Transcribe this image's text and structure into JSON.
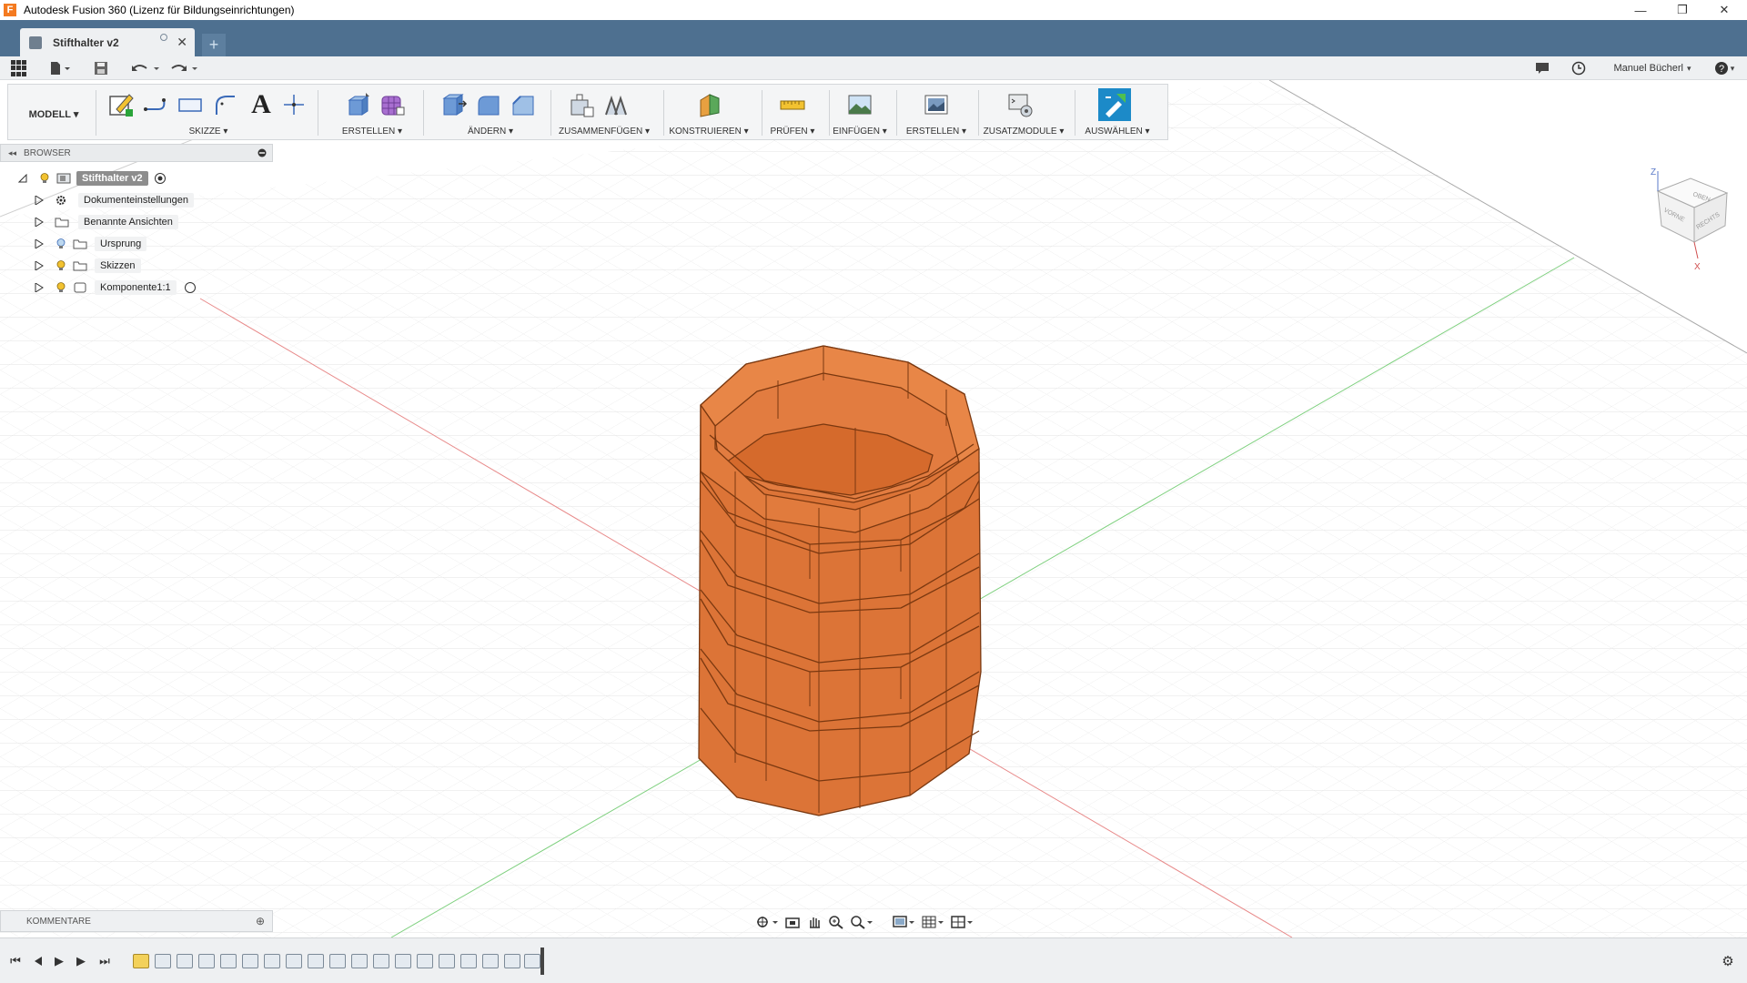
{
  "window": {
    "title": "Autodesk Fusion 360 (Lizenz für Bildungseinrichtungen)",
    "app_logo": "F",
    "minimize_icon": "—",
    "restore_icon": "❐",
    "close_icon": "✕"
  },
  "document_tab": {
    "name": "Stifthalter v2",
    "close_icon": "✕",
    "new_tab_icon": "+"
  },
  "quick_access": {
    "file_icon": "file-icon",
    "save_icon": "save-icon",
    "undo_icon": "undo-icon",
    "redo_icon": "redo-icon",
    "user_name": "Manuel Bücherl",
    "user_caret": "▾",
    "help_caret": "▾"
  },
  "ribbon": {
    "mode": "MODELL ▾",
    "groups": [
      {
        "label": "SKIZZE ▾"
      },
      {
        "label": "ERSTELLEN ▾"
      },
      {
        "label": "ÄNDERN ▾"
      },
      {
        "label": "ZUSAMMENFÜGEN ▾"
      },
      {
        "label": "KONSTRUIEREN ▾"
      },
      {
        "label": "PRÜFEN ▾"
      },
      {
        "label": "EINFÜGEN ▾"
      },
      {
        "label": "ERSTELLEN ▾"
      },
      {
        "label": "ZUSATZMODULE ▾"
      },
      {
        "label": "AUSWÄHLEN ▾"
      }
    ],
    "text_tool": "A"
  },
  "browser": {
    "title": "BROWSER",
    "collapse_icon": "◂◂",
    "items": [
      {
        "label": "Stifthalter v2"
      },
      {
        "label": "Dokumenteinstellungen"
      },
      {
        "label": "Benannte Ansichten"
      },
      {
        "label": "Ursprung"
      },
      {
        "label": "Skizzen"
      },
      {
        "label": "Komponente1:1"
      }
    ]
  },
  "viewcube": {
    "top": "OBEN",
    "front": "VORNE",
    "right": "RECHTS",
    "axis_z": "Z",
    "axis_x": "X"
  },
  "comments": {
    "title": "KOMMENTARE",
    "add_icon": "⊕"
  },
  "timeline": {
    "first_icon": "⏮",
    "prev_icon": "◀",
    "play_icon": "▶",
    "next_icon": "▶",
    "last_icon": "⏭",
    "settings_icon": "⚙",
    "feature_count": 19
  },
  "colors": {
    "tab_bar": "#4e7090",
    "model_face": "#e07a3a",
    "model_top": "#e68142",
    "model_edge": "#7a3810",
    "selection_tool": "#1c8ac8"
  }
}
